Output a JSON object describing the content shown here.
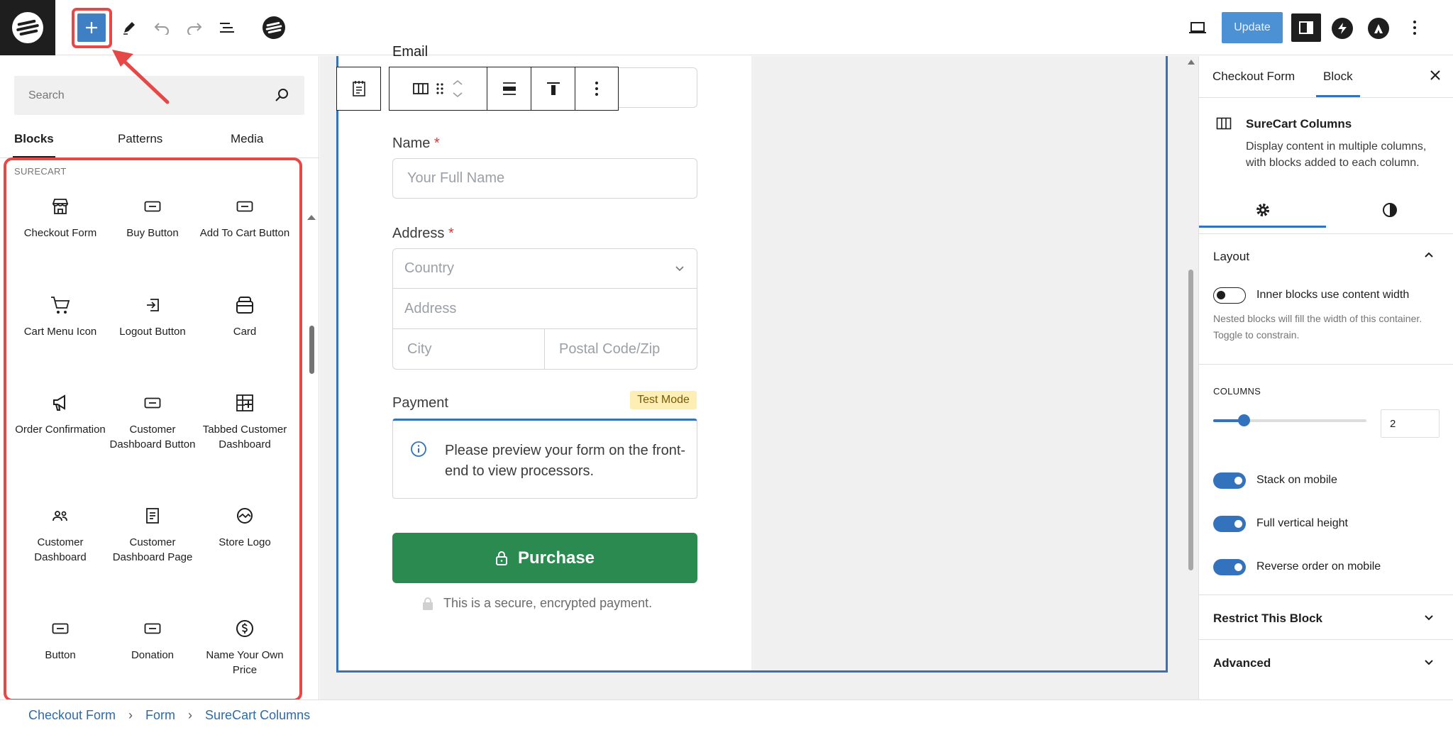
{
  "toolbar": {
    "update_label": "Update"
  },
  "inserter": {
    "search_placeholder": "Search",
    "tabs": [
      {
        "label": "Blocks"
      },
      {
        "label": "Patterns"
      },
      {
        "label": "Media"
      }
    ],
    "category_label": "SURECART",
    "blocks": [
      {
        "label": "Checkout Form",
        "icon": "storefront-icon"
      },
      {
        "label": "Buy Button",
        "icon": "button-icon"
      },
      {
        "label": "Add To Cart Button",
        "icon": "button-icon"
      },
      {
        "label": "Cart Menu Icon",
        "icon": "cart-icon"
      },
      {
        "label": "Logout Button",
        "icon": "logout-icon"
      },
      {
        "label": "Card",
        "icon": "card-icon"
      },
      {
        "label": "Order Confirmation",
        "icon": "megaphone-icon"
      },
      {
        "label": "Customer Dashboard Button",
        "icon": "button-icon"
      },
      {
        "label": "Tabbed Customer Dashboard",
        "icon": "table-plus-icon"
      },
      {
        "label": "Customer Dashboard",
        "icon": "users-icon"
      },
      {
        "label": "Customer Dashboard Page",
        "icon": "document-icon"
      },
      {
        "label": "Store Logo",
        "icon": "logo-icon"
      },
      {
        "label": "Button",
        "icon": "button-icon"
      },
      {
        "label": "Donation",
        "icon": "button-icon"
      },
      {
        "label": "Name Your Own Price",
        "icon": "dollar-icon"
      }
    ]
  },
  "form": {
    "email_label": "Email",
    "name_label": "Name",
    "name_required": "*",
    "name_placeholder": "Your Full Name",
    "address_label": "Address",
    "address_required": "*",
    "country_placeholder": "Country",
    "address_placeholder": "Address",
    "city_placeholder": "City",
    "postal_placeholder": "Postal Code/Zip",
    "payment_label": "Payment",
    "test_mode_badge": "Test Mode",
    "payment_notice": "Please preview your form on the front-end to view processors.",
    "purchase_label": "Purchase",
    "secure_note": "This is a secure, encrypted payment."
  },
  "settings": {
    "tabs": [
      {
        "label": "Checkout Form"
      },
      {
        "label": "Block"
      }
    ],
    "block_title": "SureCart Columns",
    "block_description": "Display content in multiple columns, with blocks added to each column.",
    "layout_title": "Layout",
    "inner_blocks_label": "Inner blocks use content width",
    "inner_blocks_help": "Nested blocks will fill the width of this container. Toggle to constrain.",
    "columns_label": "COLUMNS",
    "columns_value": "2",
    "columns_slider_fraction": 0.2,
    "toggles": [
      {
        "label": "Stack on mobile",
        "on": true
      },
      {
        "label": "Full vertical height",
        "on": true
      },
      {
        "label": "Reverse order on mobile",
        "on": true
      }
    ],
    "restrict_title": "Restrict This Block",
    "advanced_title": "Advanced"
  },
  "breadcrumb": {
    "items": [
      "Checkout Form",
      "Form",
      "SureCart Columns"
    ],
    "separator": "›"
  },
  "colors": {
    "accent": "#3372bd",
    "highlight": "#e64848",
    "purchase": "#2b8a4f"
  }
}
